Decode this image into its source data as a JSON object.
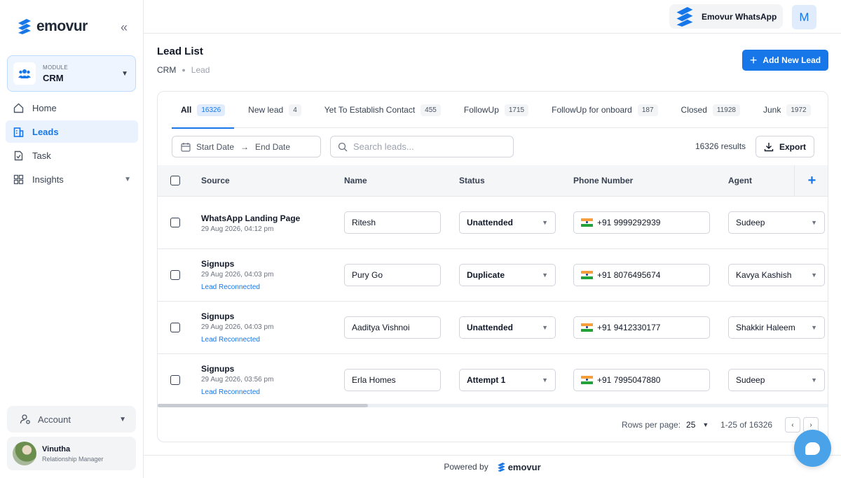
{
  "brand": {
    "name": "emovur",
    "color": "#1777e8"
  },
  "sidebar": {
    "collapse_icon": "double-chevron-left-icon",
    "module": {
      "label": "MODULE",
      "value": "CRM"
    },
    "nav": [
      {
        "label": "Home",
        "icon": "home-icon",
        "active": false
      },
      {
        "label": "Leads",
        "icon": "building-icon",
        "active": true
      },
      {
        "label": "Task",
        "icon": "task-icon",
        "active": false
      },
      {
        "label": "Insights",
        "icon": "grid-icon",
        "active": false
      }
    ],
    "account": {
      "label": "Account"
    },
    "user": {
      "name": "Vinutha",
      "role": "Relationship Manager"
    }
  },
  "topbar": {
    "whatsapp_label": "Emovur WhatsApp",
    "avatar_letter": "M"
  },
  "header": {
    "title": "Lead List",
    "breadcrumb": [
      "CRM",
      "Lead"
    ],
    "add_button": "Add New Lead"
  },
  "tabs": [
    {
      "label": "All",
      "count": "16326",
      "active": true
    },
    {
      "label": "New lead",
      "count": "4"
    },
    {
      "label": "Yet To Establish Contact",
      "count": "455"
    },
    {
      "label": "FollowUp",
      "count": "1715"
    },
    {
      "label": "FollowUp for onboard",
      "count": "187"
    },
    {
      "label": "Closed",
      "count": "11928"
    },
    {
      "label": "Junk",
      "count": "1972"
    }
  ],
  "filters": {
    "start_date": "Start Date",
    "end_date": "End Date",
    "search_placeholder": "Search leads...",
    "results": "16326 results",
    "export_label": "Export"
  },
  "table": {
    "columns": [
      "Source",
      "Name",
      "Status",
      "Phone Number",
      "Agent"
    ],
    "rows": [
      {
        "source": "WhatsApp Landing Page",
        "date": "29 Aug 2026, 04:12 pm",
        "tag": "",
        "name": "Ritesh",
        "status": "Unattended",
        "phone": "+91 9999292939",
        "agent": "Sudeep"
      },
      {
        "source": "Signups",
        "date": "29 Aug 2026, 04:03 pm",
        "tag": "Lead Reconnected",
        "name": "Pury Go",
        "status": "Duplicate",
        "phone": "+91 8076495674",
        "agent": "Kavya Kashish"
      },
      {
        "source": "Signups",
        "date": "29 Aug 2026, 04:03 pm",
        "tag": "Lead Reconnected",
        "name": "Aaditya Vishnoi",
        "status": "Unattended",
        "phone": "+91 9412330177",
        "agent": "Shakkir Haleem"
      },
      {
        "source": "Signups",
        "date": "29 Aug 2026, 03:56 pm",
        "tag": "Lead Reconnected",
        "name": "Erla Homes",
        "status": "Attempt 1",
        "phone": "+91 7995047880",
        "agent": "Sudeep"
      }
    ]
  },
  "pagination": {
    "rows_label": "Rows per page:",
    "rows_value": "25",
    "range": "1-25 of 16326"
  },
  "footer": {
    "powered_by": "Powered by",
    "logo_text": "emovur"
  }
}
